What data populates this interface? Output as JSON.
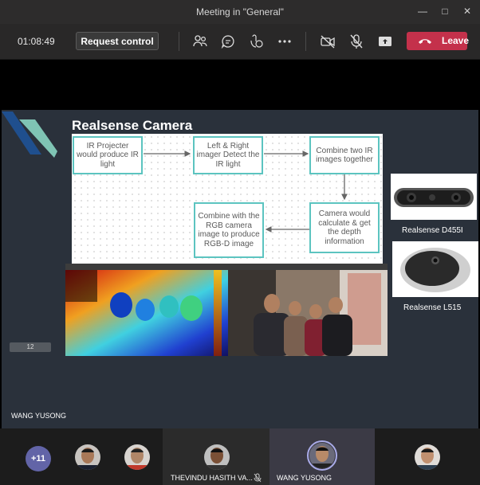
{
  "window": {
    "title": "Meeting in \"General\""
  },
  "toolbar": {
    "timer": "01:08:49",
    "request_control": "Request control",
    "leave": "Leave",
    "leave_color": "#c4314b",
    "icons": [
      "participants-icon",
      "chat-icon",
      "reactions-icon",
      "more-options-icon",
      "camera-off-icon",
      "mic-off-icon",
      "share-tray-icon"
    ]
  },
  "slide": {
    "title": "Realsense Camera",
    "flow_boxes": [
      "IR Projecter would produce IR light",
      "Left & Right imager Detect the IR light",
      "Combine two IR images together",
      "Camera would calculate & get the depth information",
      "Combine with the RGB camera image to produce RGB-D image"
    ],
    "cameras": [
      "Realsense D455I",
      "Realsense L515"
    ],
    "page_indicator": "12"
  },
  "stage": {
    "presenter": "WANG YUSONG"
  },
  "gallery": {
    "overflow_count": "+11",
    "participants": [
      {
        "name": ""
      },
      {
        "name": ""
      },
      {
        "name": "THEVINDU HASITH VA..."
      },
      {
        "name": "WANG YUSONG"
      },
      {
        "name": ""
      }
    ]
  }
}
